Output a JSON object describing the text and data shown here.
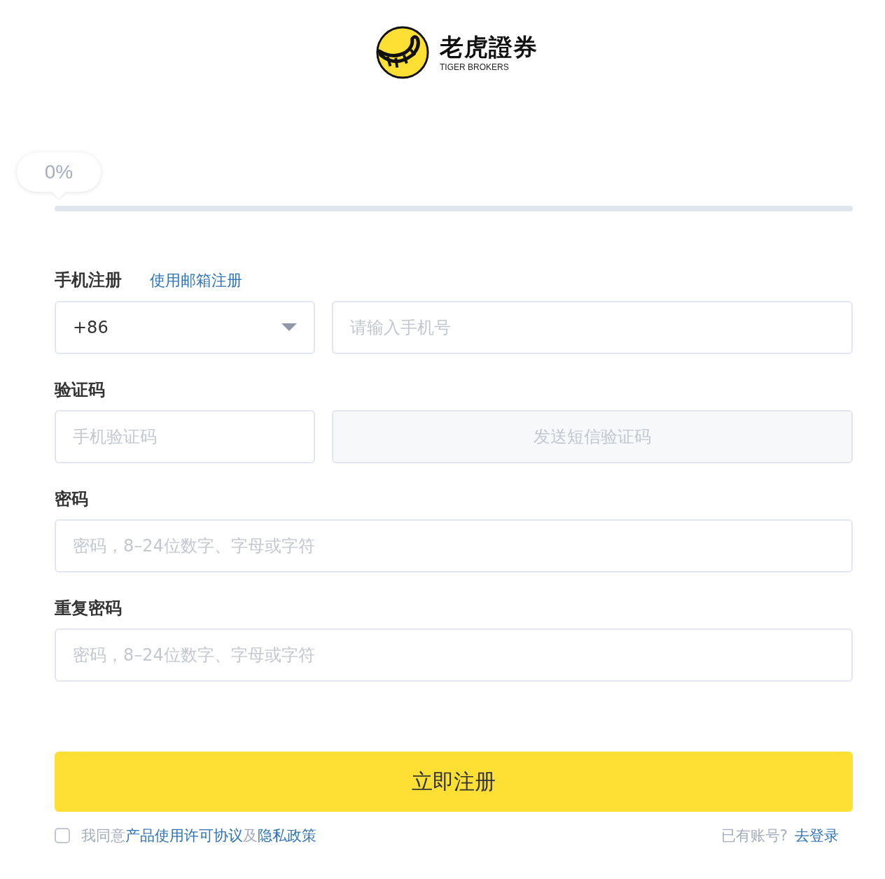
{
  "logo": {
    "name": "老虎證券",
    "subtitle": "TIGER BROKERS"
  },
  "progress": {
    "reading": "0%"
  },
  "tabs": [
    {
      "label": "手机注册",
      "selected": true
    },
    {
      "label": "使用邮箱注册",
      "selected": false
    }
  ],
  "phone": {
    "country_code": "+86",
    "placeholder": "请输入手机号"
  },
  "code": {
    "label": "验证码",
    "placeholder": "手机验证码",
    "send_button": "发送短信验证码",
    "send_disabled": true
  },
  "password": {
    "label": "密码",
    "placeholder": "密码，8–24位数字、字母或字符"
  },
  "repeat_password": {
    "label": "重复密码",
    "placeholder": "密码，8–24位数字、字母或字符"
  },
  "submit": "立即注册",
  "agreement": {
    "checked": false,
    "parts": [
      {
        "kind": "text",
        "text": "我同意"
      },
      {
        "kind": "link",
        "text": "产品使用许可协议"
      },
      {
        "kind": "text",
        "text": "及"
      },
      {
        "kind": "link",
        "text": "隐私政策"
      }
    ]
  },
  "login": {
    "prompt": "已有账号?",
    "link": "去登录"
  }
}
